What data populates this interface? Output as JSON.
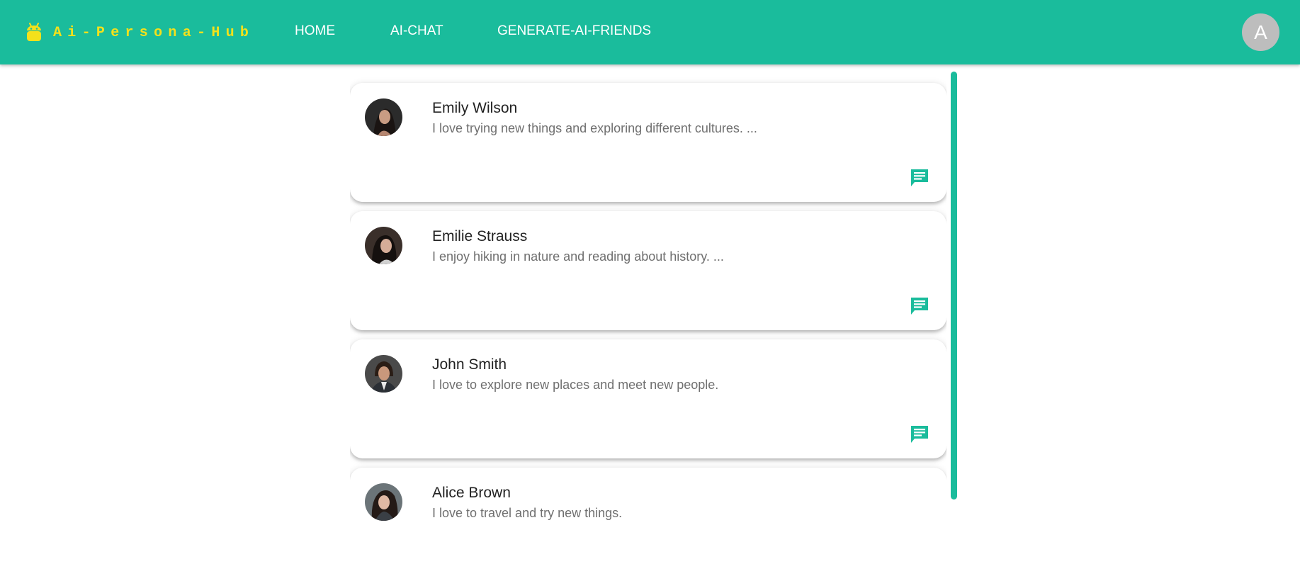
{
  "header": {
    "brand": "Ai-Persona-Hub",
    "nav": [
      {
        "label": "HOME"
      },
      {
        "label": "AI-CHAT"
      },
      {
        "label": "GENERATE-AI-FRIENDS"
      }
    ],
    "user_initial": "A"
  },
  "colors": {
    "primary": "#1abc9c",
    "brand_text": "#f4e11b",
    "avatar_bg": "#bdbdbd"
  },
  "personas": [
    {
      "name": "Emily Wilson",
      "description": "I love trying new things and exploring different cultures. ..."
    },
    {
      "name": "Emilie Strauss",
      "description": "I enjoy hiking in nature and reading about history. ..."
    },
    {
      "name": "John Smith",
      "description": "I love to explore new places and meet new people."
    },
    {
      "name": "Alice Brown",
      "description": "I love to travel and try new things."
    }
  ],
  "icons": {
    "brand": "android-robot-icon",
    "chat": "chat-bubble-icon"
  }
}
